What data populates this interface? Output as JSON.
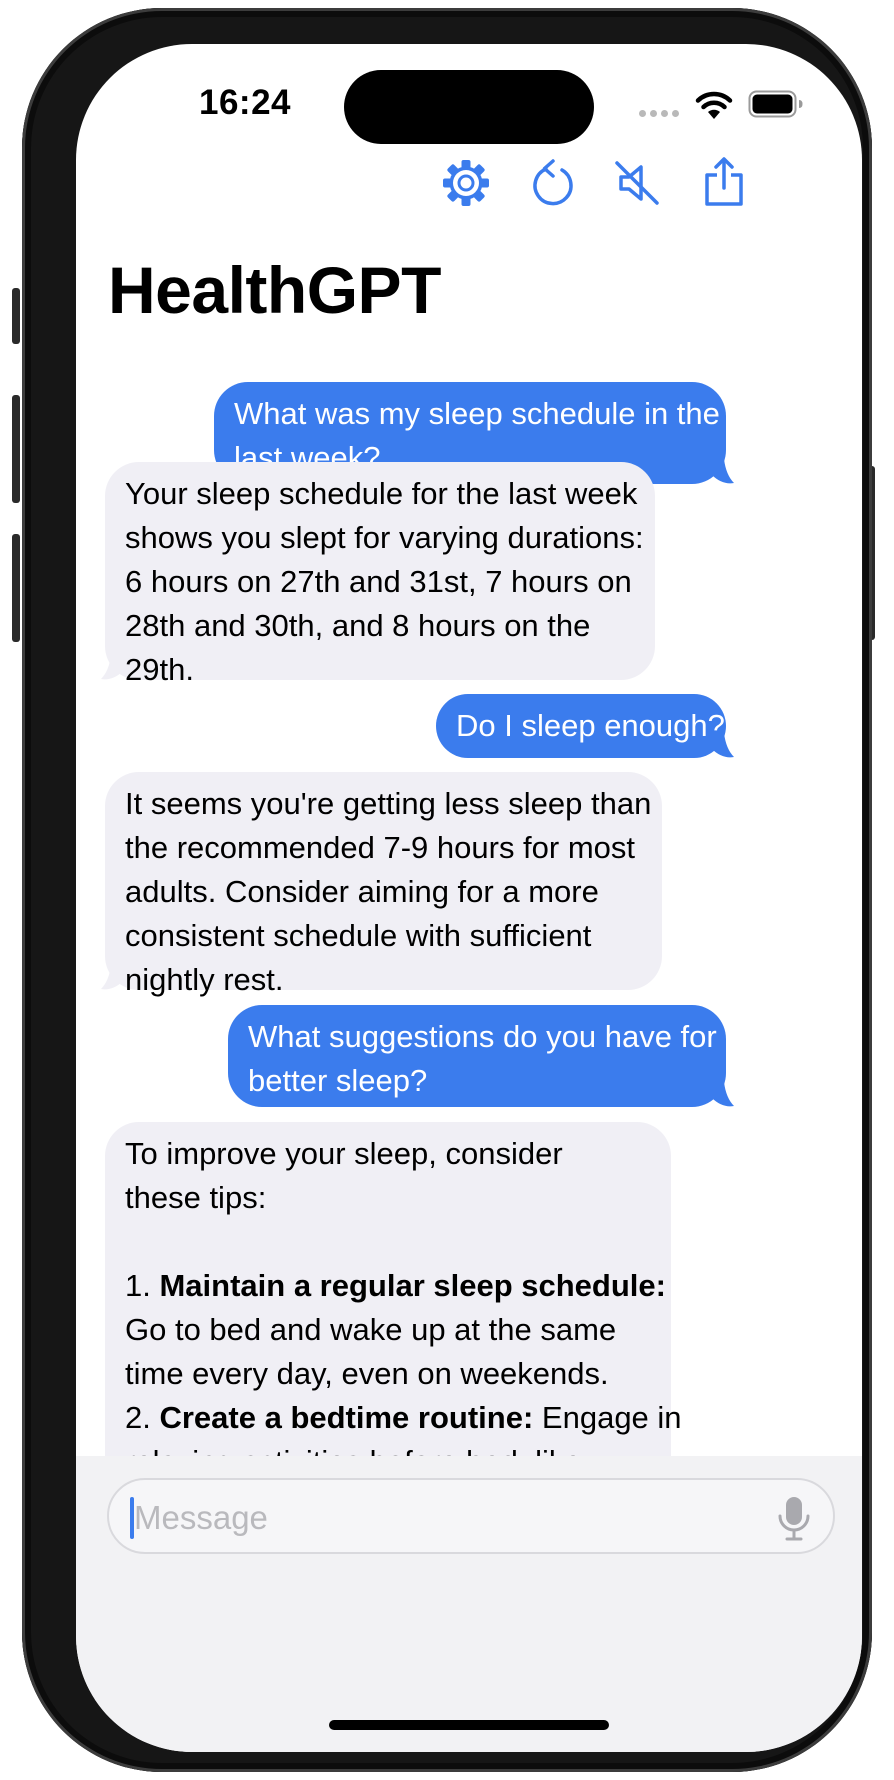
{
  "status_bar": {
    "time": "16:24"
  },
  "toolbar": {
    "settings_icon": "gear-icon",
    "reset_icon": "counterclockwise-arrow-icon",
    "mute_icon": "speaker-slash-icon",
    "share_icon": "share-icon"
  },
  "app": {
    "title": "HealthGPT"
  },
  "messages": [
    {
      "role": "user",
      "lines": [
        "What was my sleep schedule in the",
        "last week?"
      ]
    },
    {
      "role": "assistant",
      "lines": [
        "Your sleep schedule for the last week",
        "shows you slept for varying durations:",
        "6 hours on 27th and 31st, 7 hours on",
        "28th and 30th, and 8 hours on the",
        "29th."
      ]
    },
    {
      "role": "user",
      "lines": [
        "Do I sleep enough?"
      ]
    },
    {
      "role": "assistant",
      "lines": [
        "It seems you're getting less sleep than",
        "the recommended 7-9 hours for most",
        "adults. Consider aiming for a more",
        "consistent schedule with sufficient",
        "nightly rest."
      ]
    },
    {
      "role": "user",
      "lines": [
        "What suggestions do you have for",
        "better sleep?"
      ]
    },
    {
      "role": "assistant",
      "intro_lines": [
        "To improve your sleep, consider",
        "these tips:"
      ],
      "tips": [
        {
          "number": "1.",
          "title": "Maintain a regular sleep schedule:",
          "text_lines": [
            "Go to bed and wake up at the same",
            "time every day, even on weekends."
          ]
        },
        {
          "number": "2.",
          "title": "Create a bedtime routine:",
          "text_inline": "Engage in",
          "text_lines": [
            "relaxing activities before bed, like"
          ]
        }
      ]
    }
  ],
  "composer": {
    "placeholder": "Message",
    "mic_icon": "microphone-icon"
  },
  "colors": {
    "accent": "#3b7ced",
    "assistant_bubble": "#f0eff5"
  }
}
